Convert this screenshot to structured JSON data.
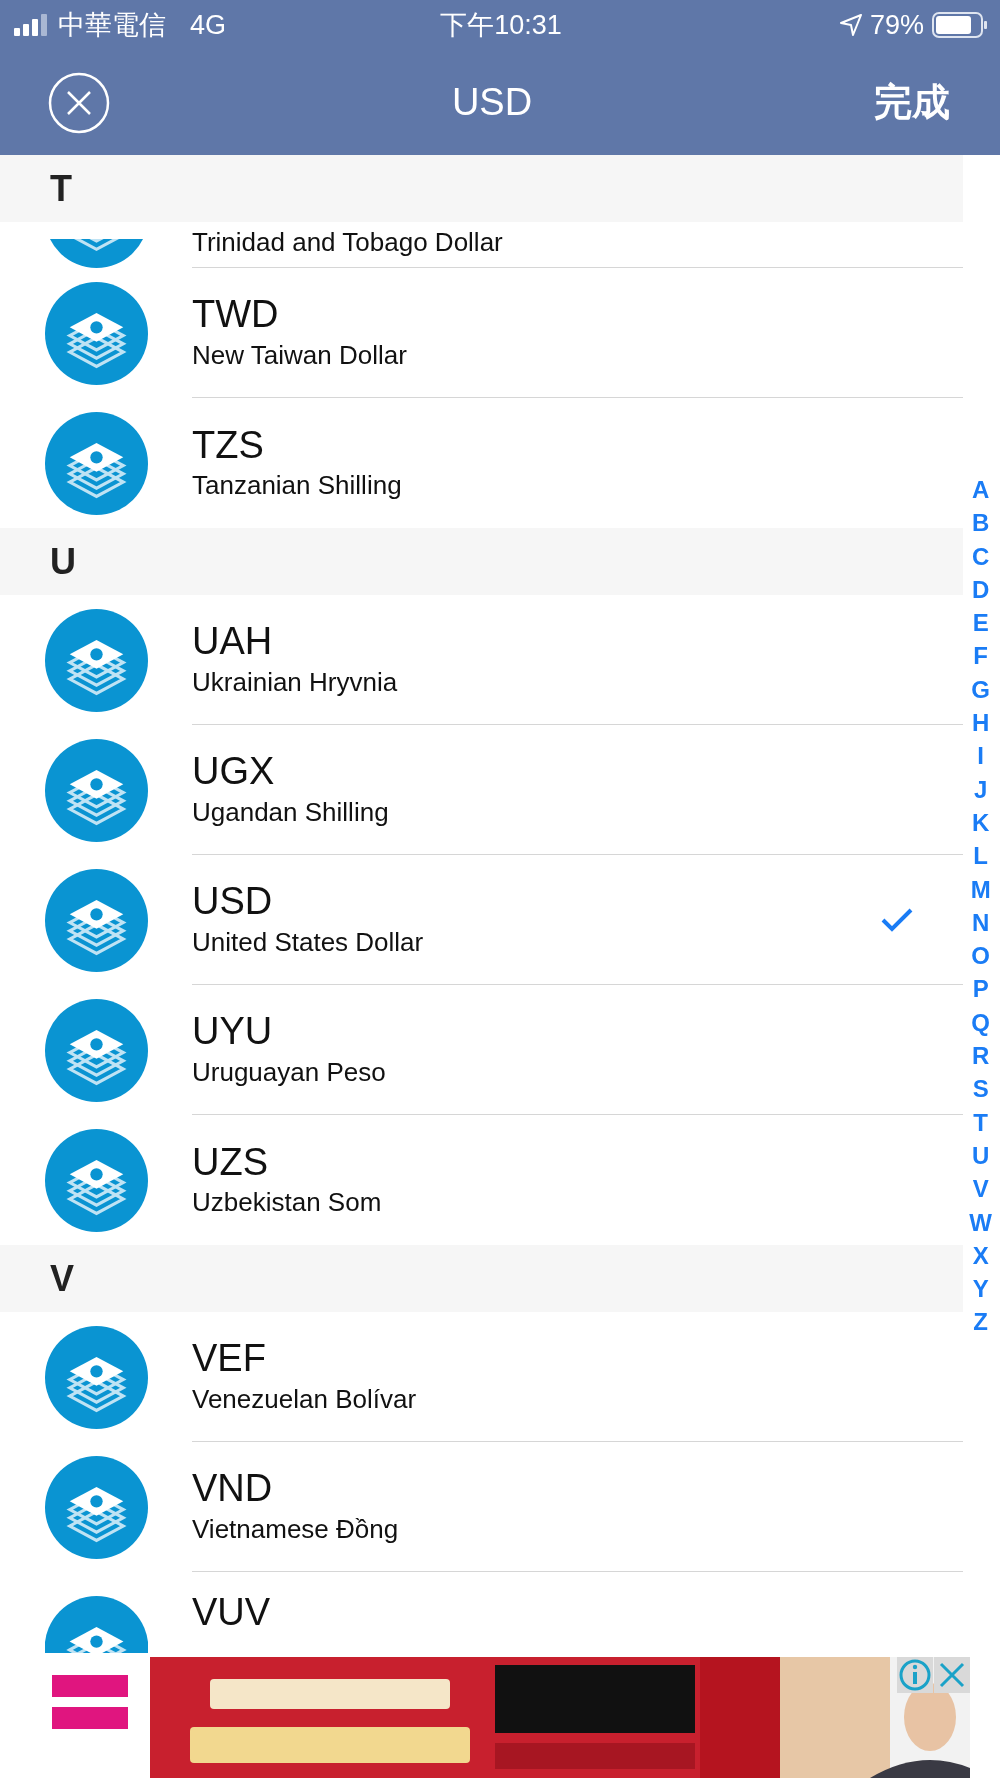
{
  "status_bar": {
    "carrier": "中華電信",
    "network": "4G",
    "time": "下午10:31",
    "battery": "79%"
  },
  "nav": {
    "title": "USD",
    "done": "完成"
  },
  "sticky_header": "T",
  "list": [
    {
      "kind": "currency",
      "name": "Trinidad and Tobago Dollar",
      "selected": false
    },
    {
      "kind": "currency",
      "code": "TWD",
      "name": "New Taiwan Dollar",
      "selected": false
    },
    {
      "kind": "currency",
      "code": "TZS",
      "name": "Tanzanian Shilling",
      "selected": false
    },
    {
      "kind": "section",
      "label": "U"
    },
    {
      "kind": "currency",
      "code": "UAH",
      "name": "Ukrainian Hryvnia",
      "selected": false
    },
    {
      "kind": "currency",
      "code": "UGX",
      "name": "Ugandan Shilling",
      "selected": false
    },
    {
      "kind": "currency",
      "code": "USD",
      "name": "United States Dollar",
      "selected": true
    },
    {
      "kind": "currency",
      "code": "UYU",
      "name": "Uruguayan Peso",
      "selected": false
    },
    {
      "kind": "currency",
      "code": "UZS",
      "name": "Uzbekistan Som",
      "selected": false
    },
    {
      "kind": "section",
      "label": "V"
    },
    {
      "kind": "currency",
      "code": "VEF",
      "name": "Venezuelan Bolívar",
      "selected": false
    },
    {
      "kind": "currency",
      "code": "VND",
      "name": "Vietnamese Đồng",
      "selected": false
    },
    {
      "kind": "currency",
      "code": "VUV",
      "selected": false
    }
  ],
  "index": [
    "A",
    "B",
    "C",
    "D",
    "E",
    "F",
    "G",
    "H",
    "I",
    "J",
    "K",
    "L",
    "M",
    "N",
    "O",
    "P",
    "Q",
    "R",
    "S",
    "T",
    "U",
    "V",
    "W",
    "X",
    "Y",
    "Z"
  ]
}
